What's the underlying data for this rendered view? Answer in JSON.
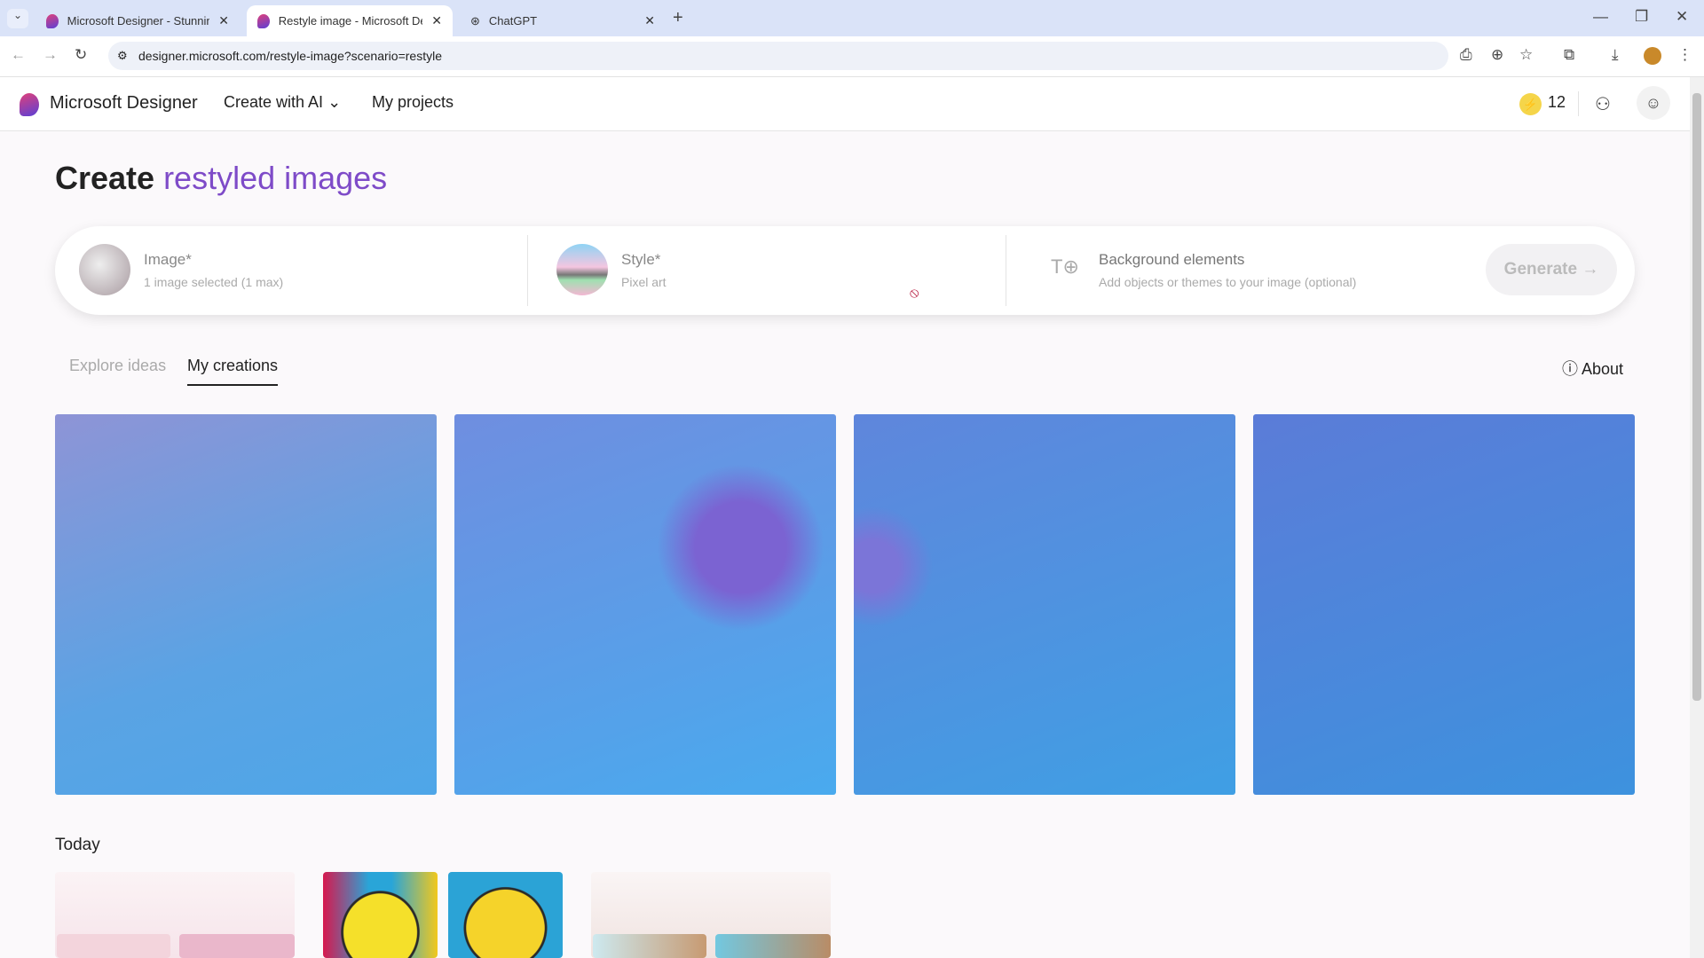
{
  "browser": {
    "tabs": [
      {
        "title": "Microsoft Designer - Stunning designs"
      },
      {
        "title": "Restyle image - Microsoft Designer"
      },
      {
        "title": "ChatGPT"
      }
    ],
    "url": "designer.microsoft.com/restyle-image?scenario=restyle"
  },
  "header": {
    "brand": "Microsoft Designer",
    "create": "Create with AI",
    "projects": "My projects",
    "credits": "12"
  },
  "page": {
    "title_a": "Create ",
    "title_b": "restyled images"
  },
  "inputs": {
    "image_label": "Image*",
    "image_sub": "1 image selected (1 max)",
    "style_label": "Style*",
    "style_sub": "Pixel art",
    "bg_label": "Background elements",
    "bg_sub": "Add objects or themes to your image (optional)",
    "generate": "Generate"
  },
  "tabs": {
    "explore": "Explore ideas",
    "mine": "My creations",
    "about": "About"
  },
  "section": {
    "today": "Today"
  },
  "colors": {
    "accent": "#7e4bc8",
    "credit": "#f5d54a"
  }
}
